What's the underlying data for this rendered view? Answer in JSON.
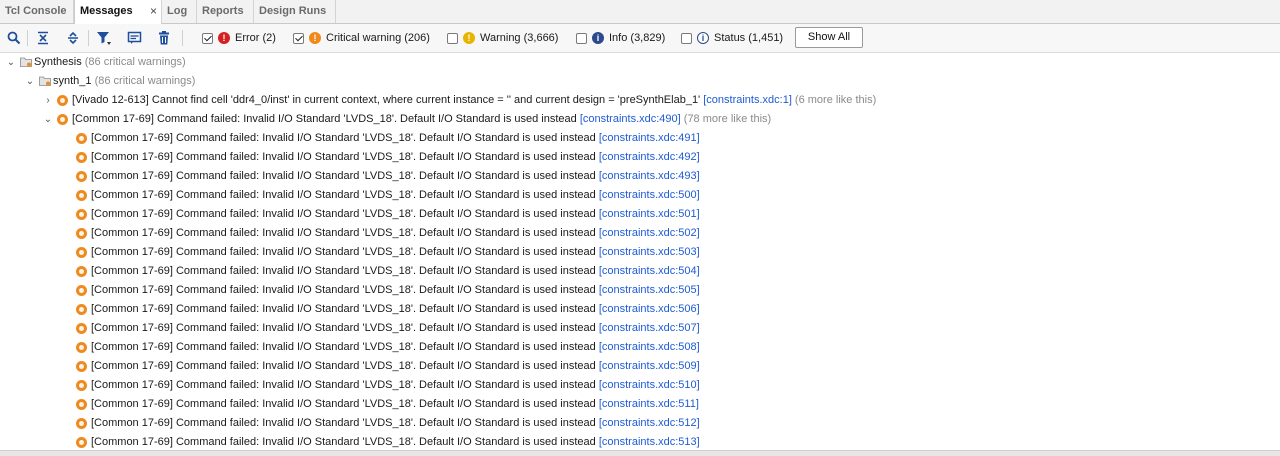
{
  "tabs": [
    {
      "label": "Tcl Console",
      "active": false
    },
    {
      "label": "Messages",
      "active": true,
      "close": "×"
    },
    {
      "label": "Log",
      "active": false
    },
    {
      "label": "Reports",
      "active": false
    },
    {
      "label": "Design Runs",
      "active": false
    }
  ],
  "toolbar": {
    "filters": {
      "error": {
        "label": "Error (2)",
        "checked": true
      },
      "critical_warning": {
        "label": "Critical warning (206)",
        "checked": true
      },
      "warning": {
        "label": "Warning (3,666)",
        "checked": false
      },
      "info": {
        "label": "Info (3,829)",
        "checked": false
      },
      "status": {
        "label": "Status (1,451)",
        "checked": false
      }
    },
    "show_all": "Show All"
  },
  "tree": {
    "synthesis": {
      "label": "Synthesis",
      "count": "(86 critical warnings)"
    },
    "synth_1": {
      "label": "synth_1",
      "count": "(86 critical warnings)"
    },
    "msg1": {
      "text": "[Vivado 12-613] Cannot find cell 'ddr4_0/inst' in current context, where current instance = '' and current design = 'preSynthElab_1' ",
      "link": "[constraints.xdc:1]",
      "more": " (6 more like this)"
    },
    "msg2": {
      "text": "[Common 17-69] Command failed: Invalid I/O Standard 'LVDS_18'. Default I/O Standard is used instead ",
      "link": "[constraints.xdc:490]",
      "more": " (78 more like this)"
    },
    "children": [
      {
        "text": "[Common 17-69] Command failed: Invalid I/O Standard 'LVDS_18'. Default I/O Standard is used instead ",
        "link": "[constraints.xdc:491]"
      },
      {
        "text": "[Common 17-69] Command failed: Invalid I/O Standard 'LVDS_18'. Default I/O Standard is used instead ",
        "link": "[constraints.xdc:492]"
      },
      {
        "text": "[Common 17-69] Command failed: Invalid I/O Standard 'LVDS_18'. Default I/O Standard is used instead ",
        "link": "[constraints.xdc:493]"
      },
      {
        "text": "[Common 17-69] Command failed: Invalid I/O Standard 'LVDS_18'. Default I/O Standard is used instead ",
        "link": "[constraints.xdc:500]"
      },
      {
        "text": "[Common 17-69] Command failed: Invalid I/O Standard 'LVDS_18'. Default I/O Standard is used instead ",
        "link": "[constraints.xdc:501]"
      },
      {
        "text": "[Common 17-69] Command failed: Invalid I/O Standard 'LVDS_18'. Default I/O Standard is used instead ",
        "link": "[constraints.xdc:502]"
      },
      {
        "text": "[Common 17-69] Command failed: Invalid I/O Standard 'LVDS_18'. Default I/O Standard is used instead ",
        "link": "[constraints.xdc:503]"
      },
      {
        "text": "[Common 17-69] Command failed: Invalid I/O Standard 'LVDS_18'. Default I/O Standard is used instead ",
        "link": "[constraints.xdc:504]"
      },
      {
        "text": "[Common 17-69] Command failed: Invalid I/O Standard 'LVDS_18'. Default I/O Standard is used instead ",
        "link": "[constraints.xdc:505]"
      },
      {
        "text": "[Common 17-69] Command failed: Invalid I/O Standard 'LVDS_18'. Default I/O Standard is used instead ",
        "link": "[constraints.xdc:506]"
      },
      {
        "text": "[Common 17-69] Command failed: Invalid I/O Standard 'LVDS_18'. Default I/O Standard is used instead ",
        "link": "[constraints.xdc:507]"
      },
      {
        "text": "[Common 17-69] Command failed: Invalid I/O Standard 'LVDS_18'. Default I/O Standard is used instead ",
        "link": "[constraints.xdc:508]"
      },
      {
        "text": "[Common 17-69] Command failed: Invalid I/O Standard 'LVDS_18'. Default I/O Standard is used instead ",
        "link": "[constraints.xdc:509]"
      },
      {
        "text": "[Common 17-69] Command failed: Invalid I/O Standard 'LVDS_18'. Default I/O Standard is used instead ",
        "link": "[constraints.xdc:510]"
      },
      {
        "text": "[Common 17-69] Command failed: Invalid I/O Standard 'LVDS_18'. Default I/O Standard is used instead ",
        "link": "[constraints.xdc:511]"
      },
      {
        "text": "[Common 17-69] Command failed: Invalid I/O Standard 'LVDS_18'. Default I/O Standard is used instead ",
        "link": "[constraints.xdc:512]"
      },
      {
        "text": "[Common 17-69] Command failed: Invalid I/O Standard 'LVDS_18'. Default I/O Standard is used instead ",
        "link": "[constraints.xdc:513]"
      }
    ]
  }
}
